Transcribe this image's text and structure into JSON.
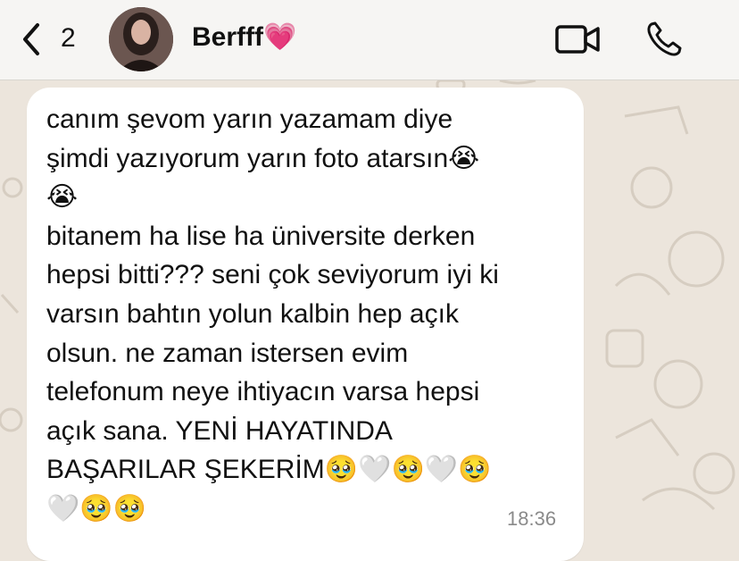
{
  "header": {
    "back_icon": "chevron-left-icon",
    "unread_count": "2",
    "contact_name": "Berfff💗",
    "video_icon": "video-camera-icon",
    "phone_icon": "phone-icon"
  },
  "message": {
    "text": "canım şevom yarın yazamam diye\nşimdi yazıyorum yarın foto atarsın😭\n😭\nbitanem ha lise ha üniversite derken\nhepsi bitti??? seni çok seviyorum iyi ki\nvarsın bahtın yolun kalbin hep açık\nolsun. ne zaman istersen evim\ntelefonum neye ihtiyacın varsa hepsi\naçık sana.  YENİ HAYATINDA\nBAŞARILAR ŞEKERİM🥹🤍🥹🤍🥹\n🤍🥹🥹",
    "time": "18:36"
  },
  "colors": {
    "header_bg": "#f6f5f3",
    "wallpaper_bg": "#ece5dc",
    "bubble_bg": "#ffffff",
    "time_text": "#8a8a8a"
  }
}
